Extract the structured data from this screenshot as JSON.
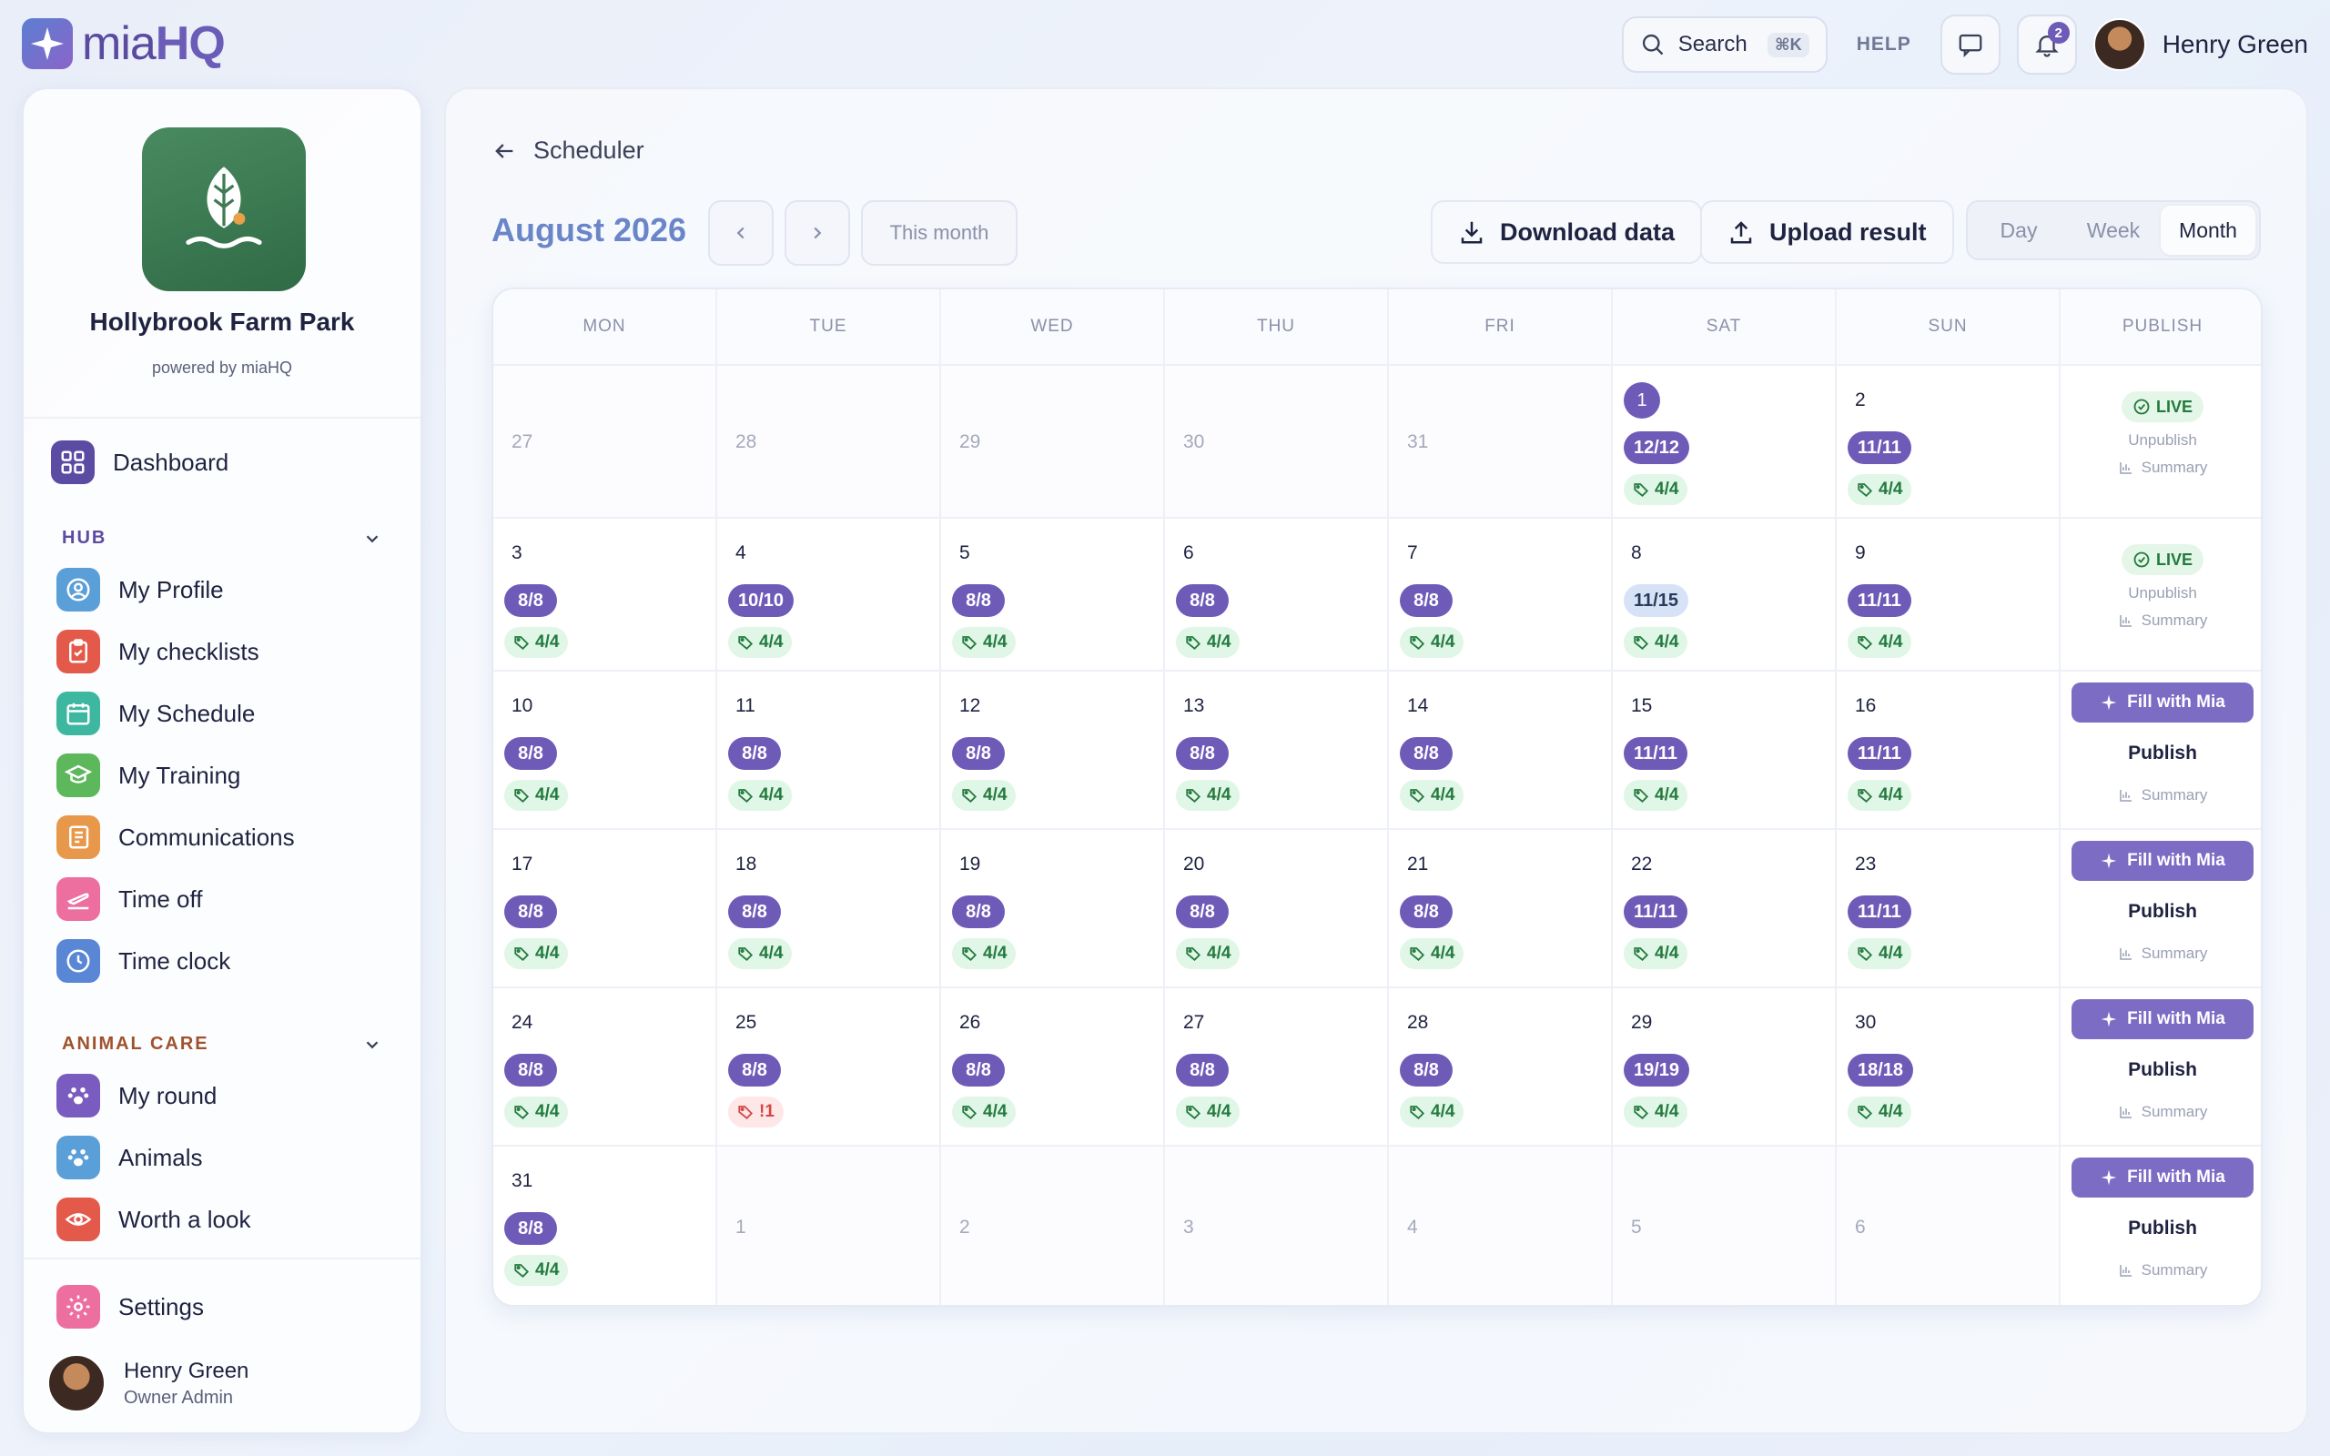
{
  "brand": {
    "logo_prefix": "mia",
    "logo_suffix": "HQ"
  },
  "topbar": {
    "search_label": "Search",
    "search_shortcut": "⌘K",
    "help_label": "HELP",
    "notifications_count": "2",
    "user_name": "Henry Green"
  },
  "sidebar": {
    "org_name": "Hollybrook Farm Park",
    "powered_by": "powered by miaHQ",
    "dashboard": "Dashboard",
    "hub_title": "HUB",
    "hub_items": [
      "My Profile",
      "My checklists",
      "My Schedule",
      "My Training",
      "Communications",
      "Time off",
      "Time clock"
    ],
    "animal_care_title": "ANIMAL CARE",
    "animal_items": [
      "My round",
      "Animals",
      "Worth a look"
    ],
    "settings": "Settings",
    "profile_name": "Henry Green",
    "profile_role": "Owner Admin"
  },
  "main": {
    "back_label": "Scheduler",
    "month_title": "August 2026",
    "this_month": "This month",
    "download_label": "Download data",
    "upload_label": "Upload result",
    "views": [
      "Day",
      "Week",
      "Month"
    ],
    "active_view": "Month"
  },
  "calendar": {
    "headers": [
      "MON",
      "TUE",
      "WED",
      "THU",
      "FRI",
      "SAT",
      "SUN",
      "PUBLISH"
    ],
    "weeks": [
      {
        "days": [
          {
            "d": "27",
            "other": true
          },
          {
            "d": "28",
            "other": true
          },
          {
            "d": "29",
            "other": true
          },
          {
            "d": "30",
            "other": true
          },
          {
            "d": "31",
            "other": true
          },
          {
            "d": "1",
            "today": true,
            "staff": "12/12",
            "tag": "4/4"
          },
          {
            "d": "2",
            "staff": "11/11",
            "tag": "4/4"
          }
        ],
        "publish": {
          "state": "live",
          "live": "LIVE",
          "unpublish": "Unpublish",
          "summary": "Summary"
        }
      },
      {
        "days": [
          {
            "d": "3",
            "staff": "8/8",
            "tag": "4/4"
          },
          {
            "d": "4",
            "staff": "10/10",
            "tag": "4/4"
          },
          {
            "d": "5",
            "staff": "8/8",
            "tag": "4/4"
          },
          {
            "d": "6",
            "staff": "8/8",
            "tag": "4/4"
          },
          {
            "d": "7",
            "staff": "8/8",
            "tag": "4/4"
          },
          {
            "d": "8",
            "staff": "11/15",
            "light": true,
            "tag": "4/4"
          },
          {
            "d": "9",
            "staff": "11/11",
            "tag": "4/4"
          }
        ],
        "publish": {
          "state": "live",
          "live": "LIVE",
          "unpublish": "Unpublish",
          "summary": "Summary"
        }
      },
      {
        "days": [
          {
            "d": "10",
            "staff": "8/8",
            "tag": "4/4"
          },
          {
            "d": "11",
            "staff": "8/8",
            "tag": "4/4"
          },
          {
            "d": "12",
            "staff": "8/8",
            "tag": "4/4"
          },
          {
            "d": "13",
            "staff": "8/8",
            "tag": "4/4"
          },
          {
            "d": "14",
            "staff": "8/8",
            "tag": "4/4"
          },
          {
            "d": "15",
            "staff": "11/11",
            "tag": "4/4"
          },
          {
            "d": "16",
            "staff": "11/11",
            "tag": "4/4"
          }
        ],
        "publish": {
          "state": "draft",
          "fill": "Fill with Mia",
          "publish": "Publish",
          "summary": "Summary"
        }
      },
      {
        "days": [
          {
            "d": "17",
            "staff": "8/8",
            "tag": "4/4"
          },
          {
            "d": "18",
            "staff": "8/8",
            "tag": "4/4"
          },
          {
            "d": "19",
            "staff": "8/8",
            "tag": "4/4"
          },
          {
            "d": "20",
            "staff": "8/8",
            "tag": "4/4"
          },
          {
            "d": "21",
            "staff": "8/8",
            "tag": "4/4"
          },
          {
            "d": "22",
            "staff": "11/11",
            "tag": "4/4"
          },
          {
            "d": "23",
            "staff": "11/11",
            "tag": "4/4"
          }
        ],
        "publish": {
          "state": "draft",
          "fill": "Fill with Mia",
          "publish": "Publish",
          "summary": "Summary"
        }
      },
      {
        "days": [
          {
            "d": "24",
            "staff": "8/8",
            "tag": "4/4"
          },
          {
            "d": "25",
            "staff": "8/8",
            "tag": "!1",
            "warn": true
          },
          {
            "d": "26",
            "staff": "8/8",
            "tag": "4/4"
          },
          {
            "d": "27",
            "staff": "8/8",
            "tag": "4/4"
          },
          {
            "d": "28",
            "staff": "8/8",
            "tag": "4/4"
          },
          {
            "d": "29",
            "staff": "19/19",
            "tag": "4/4"
          },
          {
            "d": "30",
            "staff": "18/18",
            "tag": "4/4"
          }
        ],
        "publish": {
          "state": "draft",
          "fill": "Fill with Mia",
          "publish": "Publish",
          "summary": "Summary"
        }
      },
      {
        "days": [
          {
            "d": "31",
            "staff": "8/8",
            "tag": "4/4"
          },
          {
            "d": "1",
            "other": true
          },
          {
            "d": "2",
            "other": true
          },
          {
            "d": "3",
            "other": true
          },
          {
            "d": "4",
            "other": true
          },
          {
            "d": "5",
            "other": true
          },
          {
            "d": "6",
            "other": true
          }
        ],
        "publish": {
          "state": "draft",
          "fill": "Fill with Mia",
          "publish": "Publish",
          "summary": "Summary"
        }
      }
    ]
  }
}
